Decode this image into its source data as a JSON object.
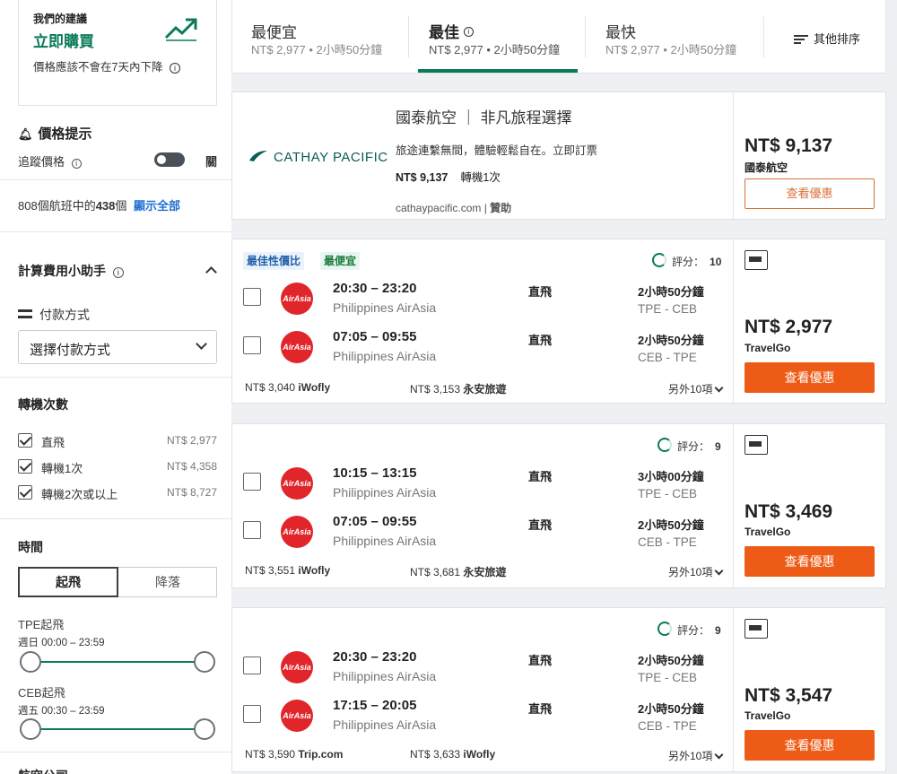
{
  "recommendation": {
    "title": "我們的建議",
    "action": "立即購買",
    "note": "價格應該不會在7天內下降",
    "info_icon": "info-icon",
    "trend_icon": "trend-up-icon",
    "accent": "#0a7a5a"
  },
  "price_alert": {
    "title": "價格提示",
    "track_label": "追蹤價格",
    "toggle_label": "關"
  },
  "results": {
    "summary_prefix": "808個航班中的",
    "shown_count": "438",
    "summary_suffix": "個",
    "show_all": "顯示全部"
  },
  "fee_helper": {
    "title": "計算費用小助手",
    "payment_label": "付款方式",
    "payment_placeholder": "選擇付款方式"
  },
  "stops_filter": {
    "title": "轉機次數",
    "options": [
      {
        "label": "直飛",
        "price": "NT$ 2,977",
        "checked": true
      },
      {
        "label": "轉機1次",
        "price": "NT$ 4,358",
        "checked": true
      },
      {
        "label": "轉機2次或以上",
        "price": "NT$ 8,727",
        "checked": true
      }
    ]
  },
  "time_filter": {
    "title": "時間",
    "tabs": [
      "起飛",
      "降落"
    ],
    "active_tab": "起飛",
    "ranges": [
      {
        "label": "TPE起飛",
        "range": "週日 00:00 – 23:59"
      },
      {
        "label": "CEB起飛",
        "range": "週五 00:30 – 23:59"
      }
    ],
    "next_section_partial": "航空公司"
  },
  "sort": {
    "tabs": [
      {
        "label": "最便宜",
        "sub": "NT$ 2,977 • 2小時50分鐘"
      },
      {
        "label": "最佳",
        "sub": "NT$ 2,977 • 2小時50分鐘",
        "active": true
      },
      {
        "label": "最快",
        "sub": "NT$ 2,977 • 2小時50分鐘"
      }
    ],
    "other": "其他排序"
  },
  "ad": {
    "brand": "CATHAY PACIFIC",
    "headline": "國泰航空 ｜ 非凡旅程選擇",
    "desc": "旅途連繫無間，體驗輕鬆自在。立即訂票",
    "price": "NT$ 9,137",
    "stops": "轉機1次",
    "url": "cathaypacific.com",
    "sponsored": "贊助",
    "side_price": "NT$ 9,137",
    "side_vendor": "國泰航空",
    "button": "查看優惠",
    "brand_color": "#0b5d52"
  },
  "flights": [
    {
      "tags": [
        "最佳性價比",
        "最便宜"
      ],
      "score_label": "評分：",
      "score": "10",
      "legs": [
        {
          "time": "20:30 – 23:20",
          "carrier": "Philippines AirAsia",
          "stops": "直飛",
          "duration": "2小時50分鐘",
          "route": "TPE - CEB"
        },
        {
          "time": "07:05 – 09:55",
          "carrier": "Philippines AirAsia",
          "stops": "直飛",
          "duration": "2小時50分鐘",
          "route": "CEB - TPE"
        }
      ],
      "alt1_price": "NT$ 3,040",
      "alt1_vendor": "iWofly",
      "alt2_price": "NT$ 3,153",
      "alt2_vendor": "永安旅遊",
      "more": "另外10項",
      "price": "NT$ 2,977",
      "vendor": "TravelGo",
      "button": "查看優惠"
    },
    {
      "tags": [],
      "score_label": "評分：",
      "score": "9",
      "legs": [
        {
          "time": "10:15 – 13:15",
          "carrier": "Philippines AirAsia",
          "stops": "直飛",
          "duration": "3小時00分鐘",
          "route": "TPE - CEB"
        },
        {
          "time": "07:05 – 09:55",
          "carrier": "Philippines AirAsia",
          "stops": "直飛",
          "duration": "2小時50分鐘",
          "route": "CEB - TPE"
        }
      ],
      "alt1_price": "NT$ 3,551",
      "alt1_vendor": "iWofly",
      "alt2_price": "NT$ 3,681",
      "alt2_vendor": "永安旅遊",
      "more": "另外10項",
      "price": "NT$ 3,469",
      "vendor": "TravelGo",
      "button": "查看優惠"
    },
    {
      "tags": [],
      "score_label": "評分：",
      "score": "9",
      "legs": [
        {
          "time": "20:30 – 23:20",
          "carrier": "Philippines AirAsia",
          "stops": "直飛",
          "duration": "2小時50分鐘",
          "route": "TPE - CEB"
        },
        {
          "time": "17:15 – 20:05",
          "carrier": "Philippines AirAsia",
          "stops": "直飛",
          "duration": "2小時50分鐘",
          "route": "CEB - TPE"
        }
      ],
      "alt1_price": "NT$ 3,590",
      "alt1_vendor": "Trip.com",
      "alt2_price": "NT$ 3,633",
      "alt2_vendor": "iWofly",
      "more": "另外10項",
      "price": "NT$ 3,547",
      "vendor": "TravelGo",
      "button": "查看優惠"
    }
  ],
  "airline_logo_text": "AirAsia",
  "colors": {
    "cta": "#ee5b17",
    "airasia": "#e0262a",
    "link": "#1f6fd0"
  }
}
